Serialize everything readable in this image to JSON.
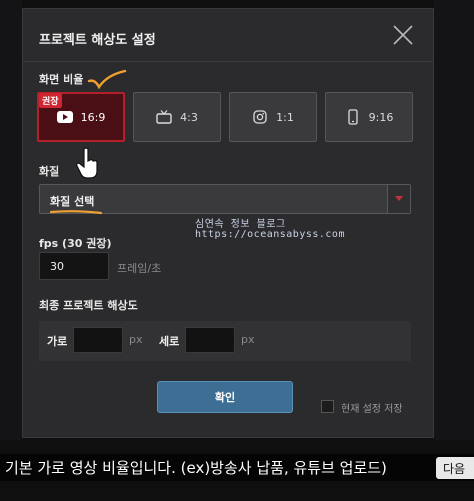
{
  "dialog": {
    "title": "프로젝트 해상도 설정",
    "aspect_ratio": {
      "label": "화면 비율",
      "options": [
        {
          "label": "16:9",
          "icon": "youtube-icon",
          "selected": true,
          "badge": "권장"
        },
        {
          "label": "4:3",
          "icon": "tv-icon",
          "selected": false
        },
        {
          "label": "1:1",
          "icon": "instagram-icon",
          "selected": false
        },
        {
          "label": "9:16",
          "icon": "phone-icon",
          "selected": false
        }
      ]
    },
    "quality": {
      "label": "화질",
      "selected_value": "화질 선택"
    },
    "fps": {
      "label": "fps (30 권장)",
      "value": "30",
      "unit": "프레임/초"
    },
    "resolution": {
      "label": "최종 프로젝트 해상도",
      "width_label": "가로",
      "width_unit": "px",
      "height_label": "세로",
      "height_unit": "px"
    },
    "ok_label": "확인",
    "save_setting_label": "현재 설정 저장"
  },
  "watermark": {
    "line1": "심연속 정보 블로그",
    "line2": "https://oceansabyss.com"
  },
  "caption": {
    "text": "기본 가로 영상 비율입니다. (ex)방송사 납품, 유튜브 업로드)",
    "next_label": "다음"
  },
  "colors": {
    "accent_selected": "#b3202a",
    "badge": "#cf2431",
    "primary_button": "#3d6f94",
    "annotation": "#f0a030"
  }
}
